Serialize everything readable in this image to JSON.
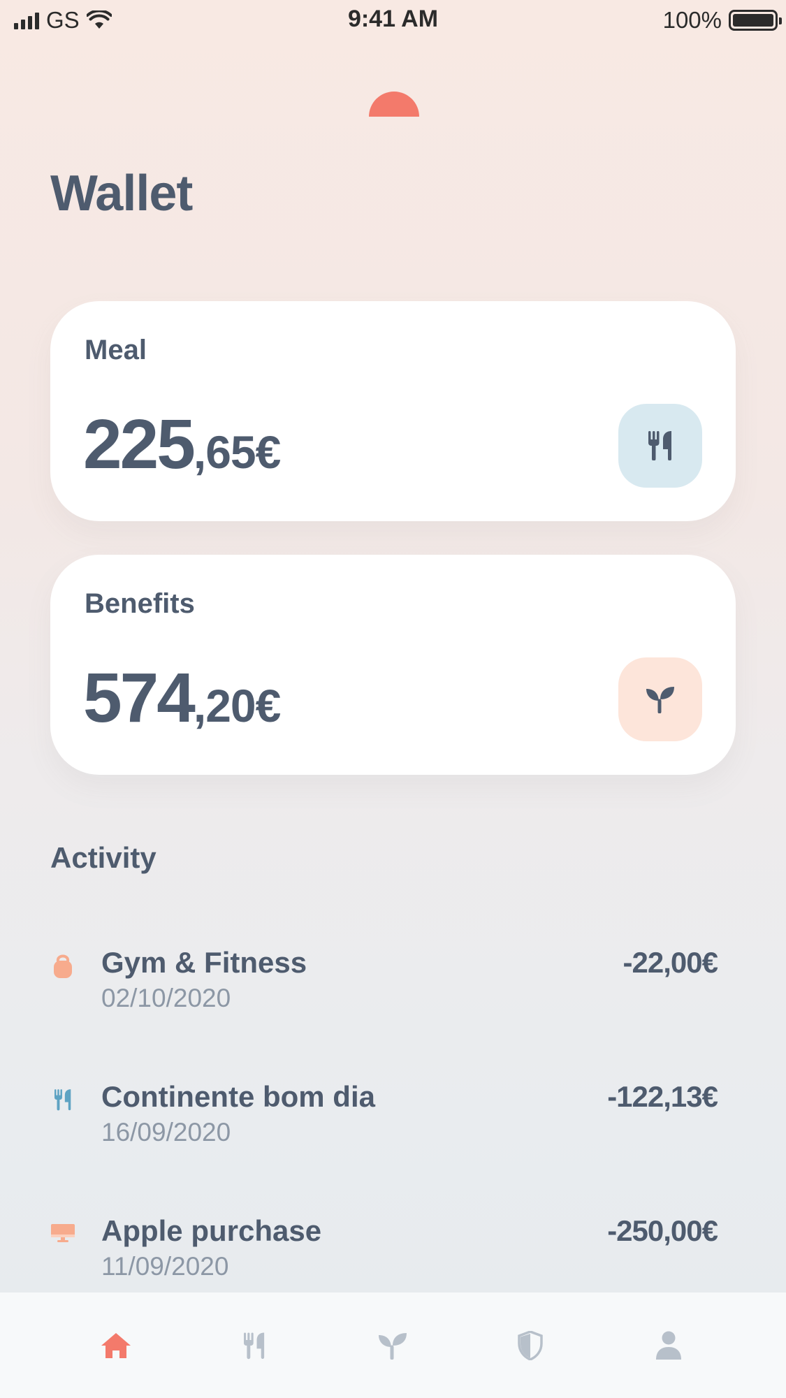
{
  "status_bar": {
    "carrier": "GS",
    "time": "9:41 AM",
    "battery": "100%"
  },
  "header": {
    "title": "Wallet",
    "logo_icon": "half-sun-icon",
    "logo_color": "#f37a6b"
  },
  "cards": {
    "meal": {
      "label": "Meal",
      "amount_int": "225",
      "amount_dec": ",65€",
      "icon": "fork-knife-icon",
      "icon_bg": "#d8e9f0"
    },
    "benefits": {
      "label": "Benefits",
      "amount_int": "574",
      "amount_dec": ",20€",
      "icon": "sprout-icon",
      "icon_bg": "#fde5da"
    }
  },
  "activity": {
    "title": "Activity",
    "items": [
      {
        "name": "Gym & Fitness",
        "date": "02/10/2020",
        "amount": "-22,00€",
        "icon": "kettlebell-icon",
        "icon_color": "#f7ab8d"
      },
      {
        "name": "Continente bom dia",
        "date": "16/09/2020",
        "amount": "-122,13€",
        "icon": "fork-knife-icon",
        "icon_color": "#5ea3c3"
      },
      {
        "name": "Apple purchase",
        "date": "11/09/2020",
        "amount": "-250,00€",
        "icon": "monitor-icon",
        "icon_color": "#f7ab8d"
      }
    ]
  },
  "tab_bar": {
    "active": "home",
    "active_color": "#f37a6b",
    "inactive_color": "#b7c0ca",
    "tabs": [
      {
        "id": "home",
        "icon": "home-icon"
      },
      {
        "id": "meal",
        "icon": "fork-knife-icon"
      },
      {
        "id": "benefits",
        "icon": "sprout-icon"
      },
      {
        "id": "insurance",
        "icon": "shield-icon"
      },
      {
        "id": "profile",
        "icon": "user-icon"
      }
    ]
  }
}
